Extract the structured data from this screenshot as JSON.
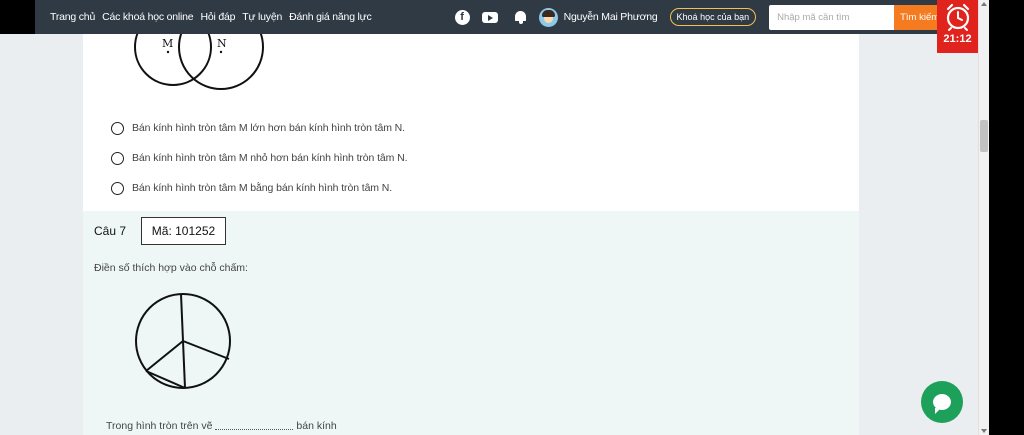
{
  "nav": {
    "links": [
      "Trang chủ",
      "Các khoá học online",
      "Hỏi đáp",
      "Tự luyện",
      "Đánh giá năng lực"
    ],
    "user_name": "Nguyễn Mai Phương",
    "courses_button": "Khoá học của bạn",
    "search_placeholder": "Nhập mã cần tìm",
    "search_button": "Tìm kiếm"
  },
  "timer": {
    "time": "21:12"
  },
  "question6": {
    "figure_labels": {
      "m": "M",
      "n": "N"
    },
    "options": [
      "Bán kính hình tròn tâm M lớn hơn bán kính hình tròn tâm N.",
      "Bán kính hình tròn tâm M nhỏ hơn bán kính hình tròn tâm N.",
      "Bán kính hình tròn tâm M bằng bán kính hình tròn tâm N."
    ]
  },
  "question7": {
    "label": "Câu 7",
    "code": "Mã: 101252",
    "prompt": "Điền số thích hợp vào chỗ chấm:",
    "answer_prefix": "Trong hình tròn trên vẽ",
    "answer_suffix": "bán kính"
  },
  "colors": {
    "navbar": "#2f3a45",
    "search_button": "#f47b20",
    "timer": "#e0231c",
    "chat": "#1ca05a",
    "courses_border": "#f2c14e"
  }
}
